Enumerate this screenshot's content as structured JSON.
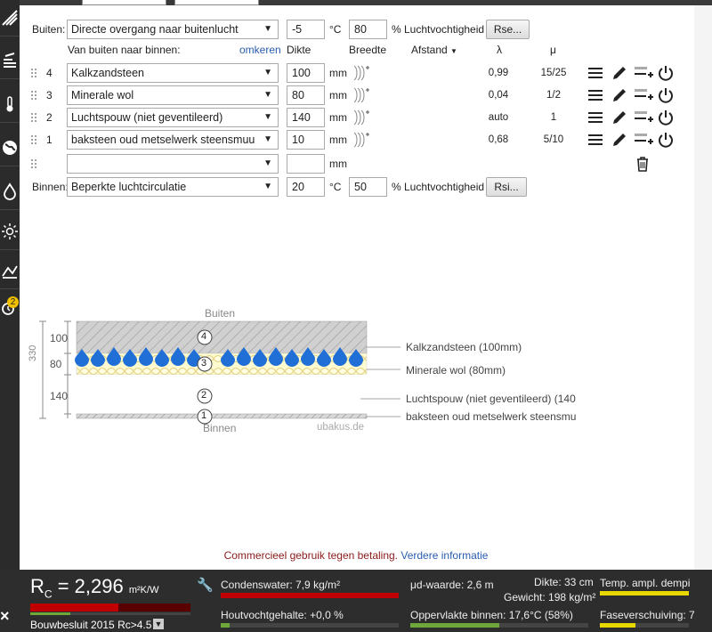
{
  "sidebar": {
    "icons": [
      "roof-icon",
      "wall-icon",
      "thermometer-icon",
      "globe-icon",
      "drop-icon",
      "sun-icon",
      "chart-icon",
      "alarm-icon"
    ],
    "badge": "2"
  },
  "outside": {
    "label": "Buiten:",
    "selection": "Directe overgang naar buitenlucht",
    "temp": "-5",
    "temp_unit": "°C",
    "humidity": "80",
    "humidity_label": "% Luchtvochtigheid",
    "button": "Rse..."
  },
  "headers": {
    "order": "Van buiten naar binnen:",
    "reverse": "omkeren",
    "thickness": "Dikte",
    "width": "Breedte",
    "distance": "Afstand",
    "lambda": "λ",
    "mu": "μ"
  },
  "layers": [
    {
      "num": "4",
      "material": "Kalkzandsteen",
      "thickness": "100",
      "unit": "mm",
      "lambda": "0,99",
      "mu": "15/25"
    },
    {
      "num": "3",
      "material": "Minerale wol",
      "thickness": "80",
      "unit": "mm",
      "lambda": "0,04",
      "mu": "1/2"
    },
    {
      "num": "2",
      "material": "Luchtspouw (niet geventileerd)",
      "thickness": "140",
      "unit": "mm",
      "lambda": "auto",
      "mu": "1"
    },
    {
      "num": "1",
      "material": "baksteen oud metselwerk steensmuu",
      "thickness": "10",
      "unit": "mm",
      "lambda": "0,68",
      "mu": "5/10"
    }
  ],
  "empty_row": {
    "unit": "mm"
  },
  "inside": {
    "label": "Binnen:",
    "selection": "Beperkte luchtcirculatie",
    "temp": "20",
    "temp_unit": "°C",
    "humidity": "50",
    "humidity_label": "% Luchtvochtigheid",
    "button": "Rsi..."
  },
  "diagram": {
    "top_label": "Buiten",
    "bottom_label": "Binnen",
    "watermark": "ubakus.de",
    "total": "330",
    "dims": [
      "100",
      "80",
      "140"
    ],
    "callouts": [
      "Kalkzandsteen (100mm)",
      "Minerale wol (80mm)",
      "Luchtspouw (niet geventileerd) (140",
      "baksteen oud metselwerk steensmu"
    ],
    "circle_nums": [
      "4",
      "3",
      "2",
      "1"
    ]
  },
  "commercial": {
    "text": "Commercieel gebruik tegen betaling.",
    "link": "Verdere informatie"
  },
  "bottom": {
    "rc_label": "R",
    "rc_sub": "C",
    "rc_eq": "=",
    "rc_value": "2,296",
    "rc_unit": "m²K/W",
    "rc_bar": 0.55,
    "standard": "Bouwbesluit 2015 Rc>4.5",
    "condensate": "Condenswater: 7,9 kg/m²",
    "wood_moisture": "Houtvochtgehalte: +0,0 %",
    "sd": "μd-waarde: 2,6 m",
    "thickness": "Dikte: 33 cm",
    "weight": "Gewicht: 198 kg/m²",
    "surface": "Oppervlakte binnen: 17,6°C (58%)",
    "temp_ampl": "Temp. ampl. dempi",
    "phase": "Faseverschuiving: 7"
  },
  "colors": {
    "accent": "#c00000",
    "bar_green": "#6ea83a",
    "yellow": "#e8d800"
  }
}
